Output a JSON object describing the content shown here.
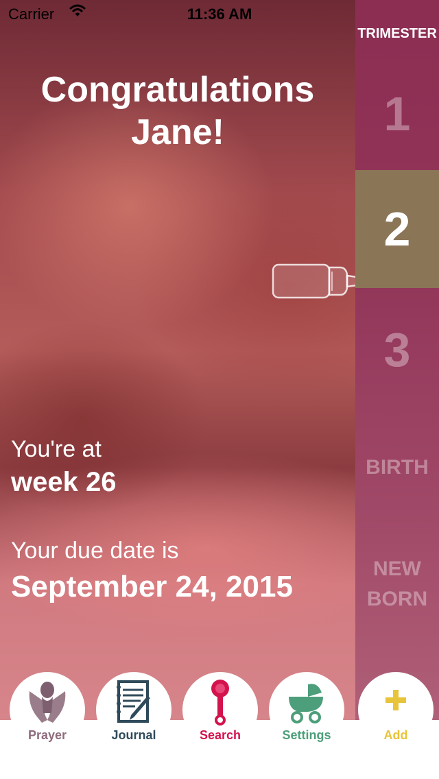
{
  "status": {
    "carrier": "Carrier",
    "time": "11:36 AM"
  },
  "headline": {
    "line1": "Congratulations",
    "line2": "Jane!"
  },
  "progress": {
    "label": "You're at",
    "value": "week 26"
  },
  "due": {
    "label": "Your due date is",
    "value": "September 24, 2015"
  },
  "sidebar": {
    "title": "TRIMESTER",
    "items": [
      {
        "label": "1"
      },
      {
        "label": "2",
        "active": true
      },
      {
        "label": "3"
      },
      {
        "label": "BIRTH"
      },
      {
        "line1": "NEW",
        "line2": "BORN"
      }
    ]
  },
  "tabs": [
    {
      "label": "Prayer",
      "icon": "prayer-hands-icon",
      "color": "#8e6b7d"
    },
    {
      "label": "Journal",
      "icon": "journal-icon",
      "color": "#2f4a5a"
    },
    {
      "label": "Search",
      "icon": "rattle-icon",
      "color": "#d4134d"
    },
    {
      "label": "Settings",
      "icon": "stroller-icon",
      "color": "#4d9e7a"
    },
    {
      "label": "Add",
      "icon": "plus-icon",
      "color": "#e8c43a"
    }
  ],
  "colors": {
    "sidebar": "#8c2d52",
    "active_trimester": "#8b7557"
  }
}
